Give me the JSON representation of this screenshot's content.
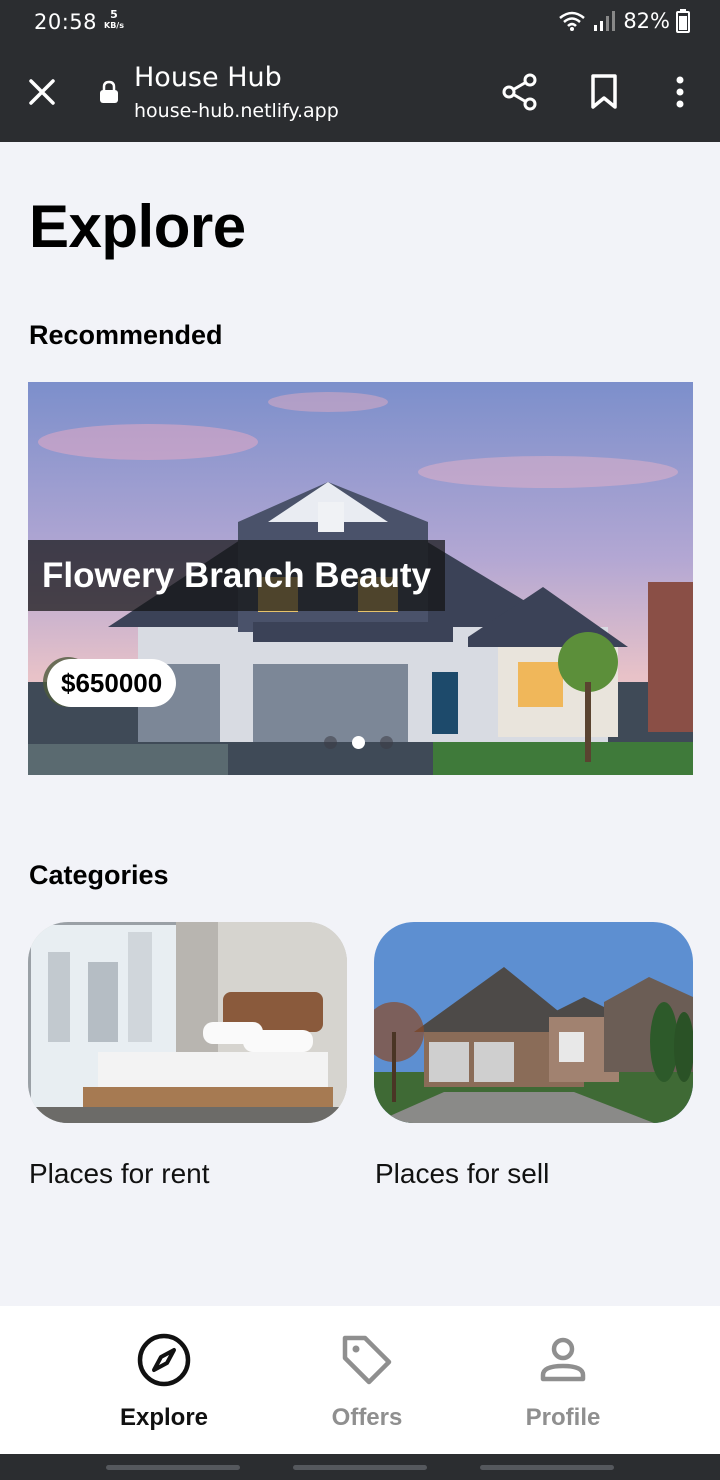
{
  "status_bar": {
    "time": "20:58",
    "net_speed": "5",
    "net_unit": "KB/s",
    "battery": "82%"
  },
  "browser": {
    "title": "House Hub",
    "url": "house-hub.netlify.app",
    "icons": [
      "close-icon",
      "lock-icon",
      "share-icon",
      "bookmark-icon",
      "more-vert-icon"
    ]
  },
  "page": {
    "title": "Explore",
    "recommended_title": "Recommended",
    "categories_title": "Categories"
  },
  "recommended": {
    "slide_name": "Flowery Branch Beauty",
    "price": "$650000",
    "slide_count": 3,
    "active_slide": 2
  },
  "categories": [
    {
      "label": "Places for rent"
    },
    {
      "label": "Places for sell"
    }
  ],
  "bottom_nav": [
    {
      "label": "Explore",
      "icon": "compass-icon",
      "active": true
    },
    {
      "label": "Offers",
      "icon": "tag-icon",
      "active": false
    },
    {
      "label": "Profile",
      "icon": "person-icon",
      "active": false
    }
  ],
  "colors": {
    "chrome": "#2b2d30",
    "background": "#f2f3f8",
    "nav_active": "#111111",
    "nav_inactive": "#8f8f8f"
  }
}
